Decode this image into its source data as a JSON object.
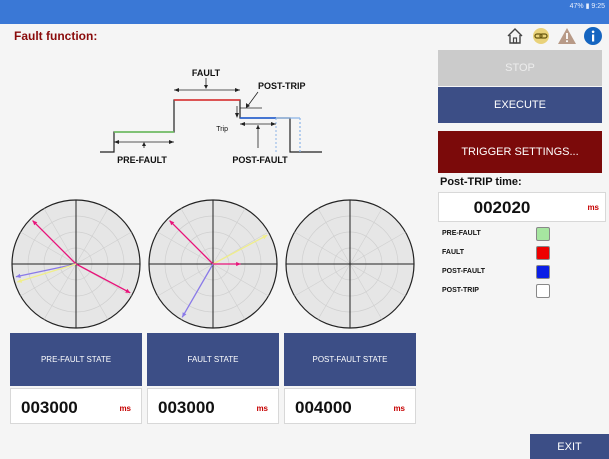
{
  "status": {
    "text": "47% ▮ 9:25"
  },
  "header": {
    "title": "Fault function:"
  },
  "icons": [
    "home-icon",
    "link-icon",
    "warning-icon",
    "info-icon"
  ],
  "diagram": {
    "fault": "FAULT",
    "post_trip": "POST-TRIP",
    "trip": "Trip",
    "pre_fault": "PRE-FAULT",
    "post_fault": "POST-FAULT"
  },
  "buttons": {
    "stop": "STOP",
    "execute": "EXECUTE",
    "trigger": "TRIGGER SETTINGS...",
    "exit": "EXIT"
  },
  "post_trip": {
    "label": "Post-TRIP time:",
    "value": "002020",
    "unit": "ms"
  },
  "legend": [
    {
      "label": "PRE-FAULT",
      "color": "#a6e6a0"
    },
    {
      "label": "FAULT",
      "color": "#ee0000"
    },
    {
      "label": "POST-FAULT",
      "color": "#0a1ee6"
    },
    {
      "label": "POST-TRIP",
      "color": "#ffffff"
    }
  ],
  "states": [
    {
      "label": "PRE-FAULT STATE",
      "value": "003000",
      "unit": "ms"
    },
    {
      "label": "FAULT STATE",
      "value": "003000",
      "unit": "ms"
    },
    {
      "label": "POST-FAULT STATE",
      "value": "004000",
      "unit": "ms"
    }
  ],
  "phasors": [
    {
      "vectors": [
        {
          "angle_deg": 135,
          "magnitude": 1.0,
          "color": "#e8137a"
        },
        {
          "angle_deg": -28,
          "magnitude": 1.0,
          "color": "#e8137a"
        },
        {
          "angle_deg": 192,
          "magnitude": 1.0,
          "color": "#8a7ae8"
        },
        {
          "angle_deg": 197,
          "magnitude": 1.0,
          "color": "#f0ee8a"
        }
      ]
    },
    {
      "vectors": [
        {
          "angle_deg": 135,
          "magnitude": 1.0,
          "color": "#e8137a"
        },
        {
          "angle_deg": 28,
          "magnitude": 1.0,
          "color": "#f0ee8a"
        },
        {
          "angle_deg": 240,
          "magnitude": 1.0,
          "color": "#8a7ae8"
        },
        {
          "angle_deg": 0,
          "magnitude": 0.45,
          "color": "#e8137a"
        }
      ]
    },
    {
      "vectors": []
    }
  ]
}
